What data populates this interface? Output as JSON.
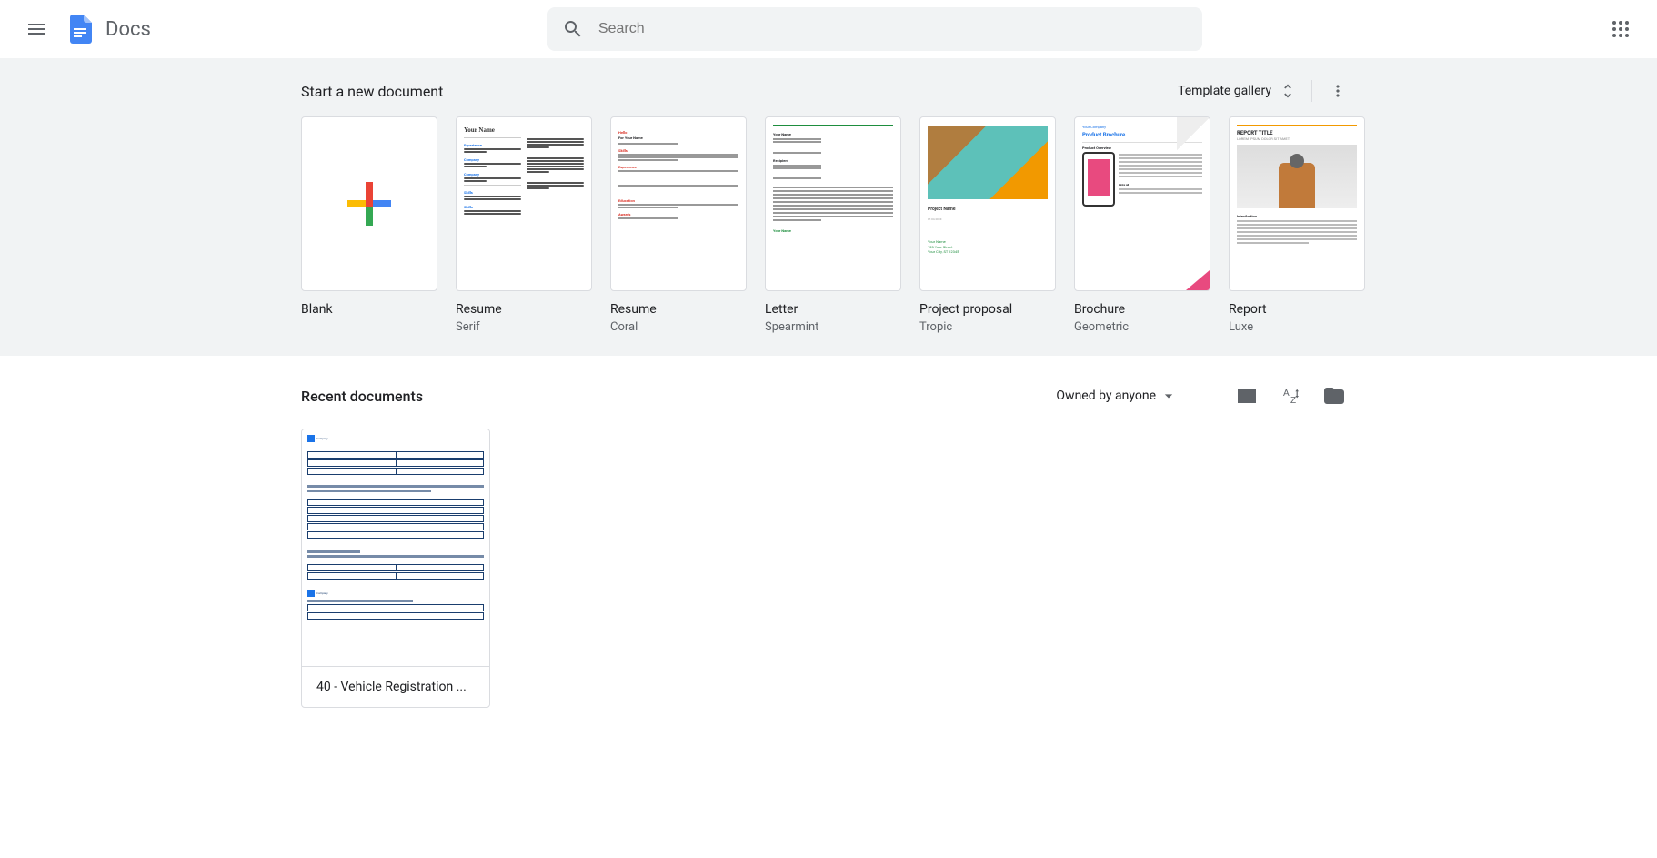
{
  "header": {
    "app_title": "Docs",
    "search_placeholder": "Search"
  },
  "templates": {
    "heading": "Start a new document",
    "gallery_label": "Template gallery",
    "items": [
      {
        "name": "Blank",
        "sub": ""
      },
      {
        "name": "Resume",
        "sub": "Serif"
      },
      {
        "name": "Resume",
        "sub": "Coral"
      },
      {
        "name": "Letter",
        "sub": "Spearmint"
      },
      {
        "name": "Project proposal",
        "sub": "Tropic"
      },
      {
        "name": "Brochure",
        "sub": "Geometric"
      },
      {
        "name": "Report",
        "sub": "Luxe"
      }
    ]
  },
  "recent": {
    "heading": "Recent documents",
    "filter_label": "Owned by anyone",
    "docs": [
      {
        "title": "40 - Vehicle Registration ..."
      }
    ]
  },
  "thumb_text": {
    "serif_name": "Your Name",
    "coral_name": "For Your Name",
    "tropic_project": "Project Name",
    "geo_company": "Your Company",
    "geo_title": "Product Brochure",
    "geo_overview": "Product Overview",
    "luxe_title": "REPORT TITLE",
    "luxe_sub": "LOREM IPSUM DOLOR SIT AMET",
    "luxe_intro": "Introduction"
  }
}
